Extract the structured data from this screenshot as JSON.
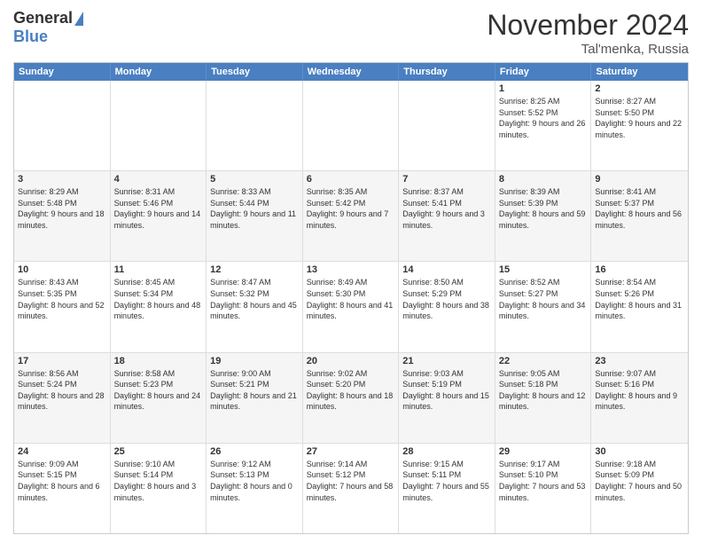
{
  "header": {
    "logo_general": "General",
    "logo_blue": "Blue",
    "title": "November 2024",
    "location": "Tal'menka, Russia"
  },
  "days_of_week": [
    "Sunday",
    "Monday",
    "Tuesday",
    "Wednesday",
    "Thursday",
    "Friday",
    "Saturday"
  ],
  "weeks": [
    {
      "alt": false,
      "cells": [
        {
          "day": "",
          "info": ""
        },
        {
          "day": "",
          "info": ""
        },
        {
          "day": "",
          "info": ""
        },
        {
          "day": "",
          "info": ""
        },
        {
          "day": "",
          "info": ""
        },
        {
          "day": "1",
          "info": "Sunrise: 8:25 AM\nSunset: 5:52 PM\nDaylight: 9 hours and 26 minutes."
        },
        {
          "day": "2",
          "info": "Sunrise: 8:27 AM\nSunset: 5:50 PM\nDaylight: 9 hours and 22 minutes."
        }
      ]
    },
    {
      "alt": true,
      "cells": [
        {
          "day": "3",
          "info": "Sunrise: 8:29 AM\nSunset: 5:48 PM\nDaylight: 9 hours and 18 minutes."
        },
        {
          "day": "4",
          "info": "Sunrise: 8:31 AM\nSunset: 5:46 PM\nDaylight: 9 hours and 14 minutes."
        },
        {
          "day": "5",
          "info": "Sunrise: 8:33 AM\nSunset: 5:44 PM\nDaylight: 9 hours and 11 minutes."
        },
        {
          "day": "6",
          "info": "Sunrise: 8:35 AM\nSunset: 5:42 PM\nDaylight: 9 hours and 7 minutes."
        },
        {
          "day": "7",
          "info": "Sunrise: 8:37 AM\nSunset: 5:41 PM\nDaylight: 9 hours and 3 minutes."
        },
        {
          "day": "8",
          "info": "Sunrise: 8:39 AM\nSunset: 5:39 PM\nDaylight: 8 hours and 59 minutes."
        },
        {
          "day": "9",
          "info": "Sunrise: 8:41 AM\nSunset: 5:37 PM\nDaylight: 8 hours and 56 minutes."
        }
      ]
    },
    {
      "alt": false,
      "cells": [
        {
          "day": "10",
          "info": "Sunrise: 8:43 AM\nSunset: 5:35 PM\nDaylight: 8 hours and 52 minutes."
        },
        {
          "day": "11",
          "info": "Sunrise: 8:45 AM\nSunset: 5:34 PM\nDaylight: 8 hours and 48 minutes."
        },
        {
          "day": "12",
          "info": "Sunrise: 8:47 AM\nSunset: 5:32 PM\nDaylight: 8 hours and 45 minutes."
        },
        {
          "day": "13",
          "info": "Sunrise: 8:49 AM\nSunset: 5:30 PM\nDaylight: 8 hours and 41 minutes."
        },
        {
          "day": "14",
          "info": "Sunrise: 8:50 AM\nSunset: 5:29 PM\nDaylight: 8 hours and 38 minutes."
        },
        {
          "day": "15",
          "info": "Sunrise: 8:52 AM\nSunset: 5:27 PM\nDaylight: 8 hours and 34 minutes."
        },
        {
          "day": "16",
          "info": "Sunrise: 8:54 AM\nSunset: 5:26 PM\nDaylight: 8 hours and 31 minutes."
        }
      ]
    },
    {
      "alt": true,
      "cells": [
        {
          "day": "17",
          "info": "Sunrise: 8:56 AM\nSunset: 5:24 PM\nDaylight: 8 hours and 28 minutes."
        },
        {
          "day": "18",
          "info": "Sunrise: 8:58 AM\nSunset: 5:23 PM\nDaylight: 8 hours and 24 minutes."
        },
        {
          "day": "19",
          "info": "Sunrise: 9:00 AM\nSunset: 5:21 PM\nDaylight: 8 hours and 21 minutes."
        },
        {
          "day": "20",
          "info": "Sunrise: 9:02 AM\nSunset: 5:20 PM\nDaylight: 8 hours and 18 minutes."
        },
        {
          "day": "21",
          "info": "Sunrise: 9:03 AM\nSunset: 5:19 PM\nDaylight: 8 hours and 15 minutes."
        },
        {
          "day": "22",
          "info": "Sunrise: 9:05 AM\nSunset: 5:18 PM\nDaylight: 8 hours and 12 minutes."
        },
        {
          "day": "23",
          "info": "Sunrise: 9:07 AM\nSunset: 5:16 PM\nDaylight: 8 hours and 9 minutes."
        }
      ]
    },
    {
      "alt": false,
      "cells": [
        {
          "day": "24",
          "info": "Sunrise: 9:09 AM\nSunset: 5:15 PM\nDaylight: 8 hours and 6 minutes."
        },
        {
          "day": "25",
          "info": "Sunrise: 9:10 AM\nSunset: 5:14 PM\nDaylight: 8 hours and 3 minutes."
        },
        {
          "day": "26",
          "info": "Sunrise: 9:12 AM\nSunset: 5:13 PM\nDaylight: 8 hours and 0 minutes."
        },
        {
          "day": "27",
          "info": "Sunrise: 9:14 AM\nSunset: 5:12 PM\nDaylight: 7 hours and 58 minutes."
        },
        {
          "day": "28",
          "info": "Sunrise: 9:15 AM\nSunset: 5:11 PM\nDaylight: 7 hours and 55 minutes."
        },
        {
          "day": "29",
          "info": "Sunrise: 9:17 AM\nSunset: 5:10 PM\nDaylight: 7 hours and 53 minutes."
        },
        {
          "day": "30",
          "info": "Sunrise: 9:18 AM\nSunset: 5:09 PM\nDaylight: 7 hours and 50 minutes."
        }
      ]
    }
  ]
}
